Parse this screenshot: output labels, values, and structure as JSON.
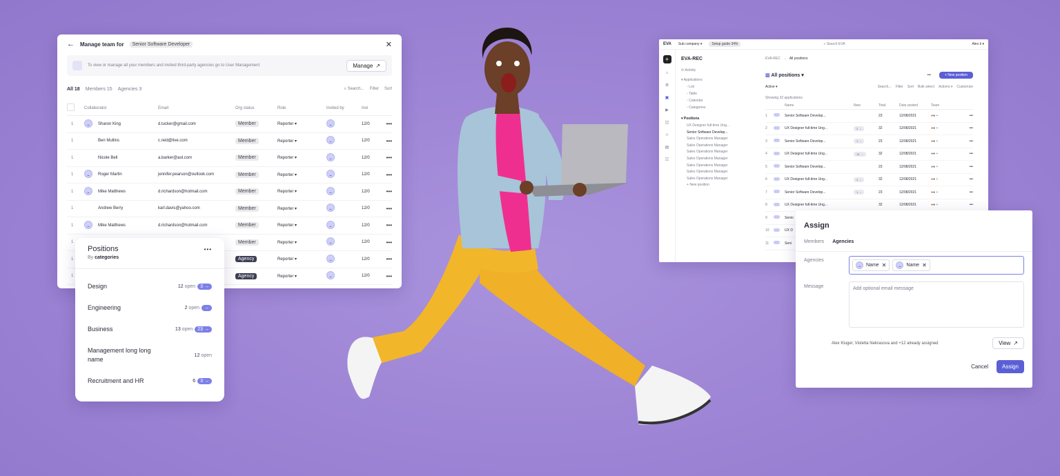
{
  "team": {
    "back_icon": "arrow-left-icon",
    "title_prefix": "Manage team for",
    "position_chip": "Senior Software Developer",
    "close_icon": "close-icon",
    "notice": "To view or manage all your members and invited third-party agencies go to User Management",
    "manage_label": "Manage",
    "tabs": [
      {
        "label": "All",
        "count": "18"
      },
      {
        "label": "Members",
        "count": "15"
      },
      {
        "label": "Agencies",
        "count": "3"
      }
    ],
    "search_placeholder": "Search...",
    "filter_label": "Filter",
    "sort_label": "Sort",
    "columns": [
      "Collaborator",
      "Email",
      "Org status",
      "Role",
      "Invited by",
      "Invi"
    ],
    "rows": [
      {
        "n": "1",
        "name": "Sharon King",
        "email": "d.tucker@gmail.com",
        "status": "Member",
        "role": "Reporter",
        "date": "12/0",
        "avatar": true,
        "agency": false
      },
      {
        "n": "1",
        "name": "Ben Mullins",
        "email": "c.reid@live.com",
        "status": "Member",
        "role": "Reporter",
        "date": "12/0",
        "avatar": false,
        "agency": false
      },
      {
        "n": "1",
        "name": "Nicole Bell",
        "email": "a.barker@aol.com",
        "status": "Member",
        "role": "Reporter",
        "date": "12/0",
        "avatar": false,
        "agency": false
      },
      {
        "n": "1",
        "name": "Roger Martin",
        "email": "jennifer.pearson@outlook.com",
        "status": "Member",
        "role": "Reporter",
        "date": "12/0",
        "avatar": true,
        "agency": false
      },
      {
        "n": "1",
        "name": "Mike Matthews",
        "email": "d.richardson@hotmail.com",
        "status": "Member",
        "role": "Reporter",
        "date": "12/0",
        "avatar": true,
        "agency": false
      },
      {
        "n": "1",
        "name": "Andrew Berry",
        "email": "karl.davis@yahoo.com",
        "status": "Member",
        "role": "Reporter",
        "date": "12/0",
        "avatar": false,
        "agency": false
      },
      {
        "n": "1",
        "name": "Mike Matthews",
        "email": "d.richardson@hotmail.com",
        "status": "Member",
        "role": "Reporter",
        "date": "12/0",
        "avatar": true,
        "agency": false
      },
      {
        "n": "1",
        "name": "",
        "email": "",
        "status": "Member",
        "role": "Reporter",
        "date": "12/0",
        "avatar": false,
        "agency": false
      },
      {
        "n": "1",
        "name": "",
        "email": "",
        "status": "Agency",
        "role": "Reporter",
        "date": "12/0",
        "avatar": false,
        "agency": true
      },
      {
        "n": "1",
        "name": "",
        "email": "",
        "status": "Agency",
        "role": "Reporter",
        "date": "12/0",
        "avatar": false,
        "agency": true
      }
    ]
  },
  "positions": {
    "title": "Positions",
    "subtitle_prefix": "By",
    "subtitle_link": "categories",
    "more_icon": "more-dots-icon",
    "items": [
      {
        "label": "Design",
        "count": "12",
        "open": "open",
        "pill": "3"
      },
      {
        "label": "Engineering",
        "count": "2",
        "open": "open",
        "pill": ""
      },
      {
        "label": "Business",
        "count": "13",
        "open": "open",
        "pill": "23"
      },
      {
        "label": "Management long long name",
        "count": "12",
        "open": "open",
        "pill": null
      },
      {
        "label": "Recruitment and HR",
        "count": "6",
        "open": "",
        "pill": "3"
      }
    ]
  },
  "eva": {
    "logo": "EVA",
    "company": "Sub company",
    "setup": "Setup guide 34%",
    "search": "Search EVA",
    "user": "Alex k",
    "title": "EVA-REC",
    "crumb1": "EVA-REC",
    "crumb_sep": "→",
    "crumb2": "All positions",
    "nav": {
      "activity": "Activity",
      "applications": "Applications",
      "list": "List",
      "table": "Table",
      "calendar": "Calendar",
      "categories": "Categories",
      "positions": "Positions",
      "pos_items": [
        "UX Designer full-time Ung...",
        "Senior Software Develop...",
        "Sales Operations Manager",
        "Sales Operations Manager",
        "Sales Operations Manager",
        "Sales Operations Manager",
        "Sales Operations Manager",
        "Sales Operations Manager",
        "Sales Operations Manager"
      ],
      "new_position": "New position"
    },
    "view_title": "All positions",
    "more": "•••",
    "new_position_btn": "New position",
    "filter_active": "Active",
    "toolbar": [
      "Search...",
      "Filter",
      "Sort",
      "Bulk select",
      "Actions",
      "Customize"
    ],
    "showing": "Showing 32 applications",
    "cols": [
      "Name",
      "New",
      "Total",
      "Date posted",
      "Team"
    ],
    "rows": [
      {
        "n": "1",
        "name": "Senior Software Develop...",
        "new": "",
        "total": "23",
        "date": "12/08/2021"
      },
      {
        "n": "2",
        "name": "UX Designer full-time Ung...",
        "new": "2",
        "total": "32",
        "date": "12/08/2021"
      },
      {
        "n": "3",
        "name": "Senior Software Develop...",
        "new": "1",
        "total": "23",
        "date": "12/08/2021"
      },
      {
        "n": "4",
        "name": "UX Designer full-time Ung...",
        "new": "14",
        "total": "32",
        "date": "12/08/2021"
      },
      {
        "n": "5",
        "name": "Senior Software Develop...",
        "new": "",
        "total": "23",
        "date": "12/08/2021"
      },
      {
        "n": "6",
        "name": "UX Designer full-time Ung...",
        "new": "2",
        "total": "32",
        "date": "12/08/2021"
      },
      {
        "n": "7",
        "name": "Senior Software Develop...",
        "new": "1",
        "total": "23",
        "date": "12/08/2021"
      },
      {
        "n": "8",
        "name": "UX Designer full-time Ung...",
        "new": "",
        "total": "32",
        "date": "12/08/2021"
      },
      {
        "n": "9",
        "name": "Senio",
        "new": "",
        "total": "",
        "date": ""
      },
      {
        "n": "10",
        "name": "UX D",
        "new": "",
        "total": "",
        "date": ""
      },
      {
        "n": "11",
        "name": "Seni",
        "new": "",
        "total": "",
        "date": ""
      }
    ]
  },
  "assign": {
    "title": "Assign",
    "tabs": [
      "Members",
      "Agencies"
    ],
    "agencies_label": "Agencies",
    "chips": [
      "Name",
      "Name"
    ],
    "message_label": "Message",
    "message_placeholder": "Add optional email message",
    "assigned_text": "Alex Kluger, Violetta Nekrasova and +12 already assigned",
    "view_label": "View",
    "cancel_label": "Cancel",
    "assign_label": "Assign"
  },
  "colors": {
    "background": "#9f86d6",
    "accent": "#5b5fd6",
    "pink_shirt": "#ef2f8f",
    "yellow_pants": "#f2b62a",
    "denim": "#a8c4d8"
  }
}
